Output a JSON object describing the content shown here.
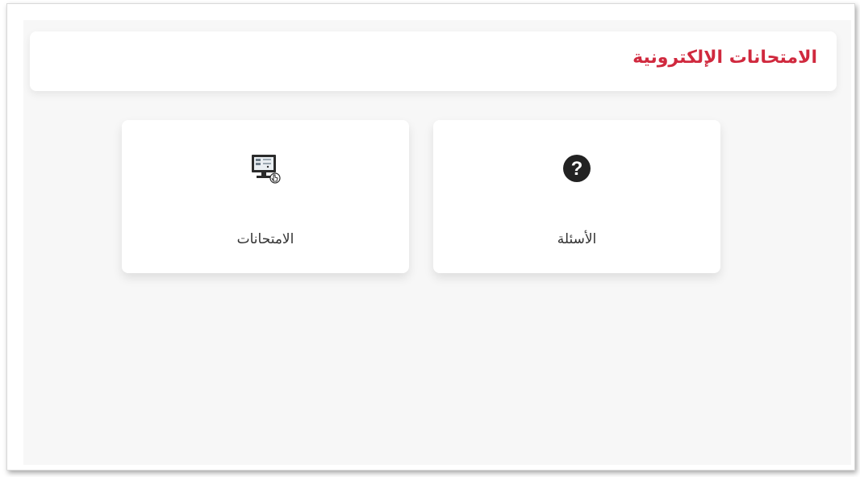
{
  "header": {
    "title": "الامتحانات الإلكترونية"
  },
  "cards": [
    {
      "label": "الأسئلة",
      "icon": "question-circle-icon"
    },
    {
      "label": "الامتحانات",
      "icon": "computer-click-icon"
    }
  ],
  "colors": {
    "title": "#d0293e",
    "card_bg": "#ffffff",
    "content_bg": "#f7f7f7",
    "icon": "#222222"
  }
}
